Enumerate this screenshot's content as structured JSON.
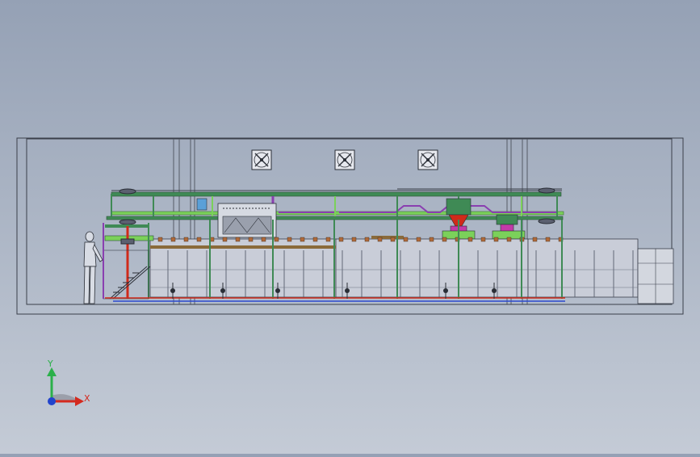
{
  "viewport": {
    "background_top": "#95a1b5",
    "background_bottom": "#c4cbd6"
  },
  "model": {
    "outline_color": "#3a3f4a",
    "frame_green": "#3f8a55",
    "lime_green": "#7bd15a",
    "purple": "#8a3fb0",
    "red": "#d02a1a",
    "blue": "#2a48d0",
    "tank_fill": "#c9cdd8",
    "pipe_magenta": "#c23aa8"
  },
  "exhaust_fans": [
    {
      "name": "fan-1"
    },
    {
      "name": "fan-2"
    },
    {
      "name": "fan-3"
    }
  ],
  "triad": {
    "y_label": "Y",
    "x_label": "X",
    "y_color": "#2bb04a",
    "x_color": "#d42a1f",
    "z_color": "#2244cc"
  }
}
